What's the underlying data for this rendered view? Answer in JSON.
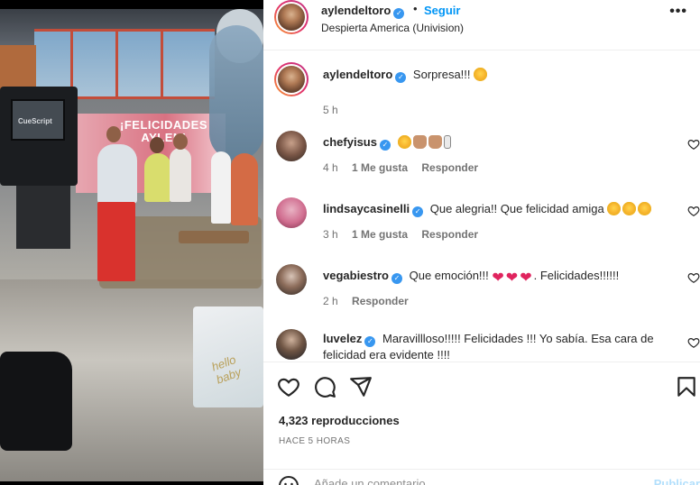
{
  "post": {
    "username": "aylendeltoro",
    "separator": "•",
    "follow_label": "Seguir",
    "location": "Despierta America (Univision)",
    "more_icon": "more-options-icon",
    "video_overlay": {
      "banner_text": "¡FELICIDADES\nAYLEN!",
      "camera_label": "CueScript",
      "bag_text": "hello baby"
    }
  },
  "caption": {
    "username": "aylendeltoro",
    "text": "Sorpresa!!!",
    "emoji": "smiling-face-with-hearts",
    "time": "5 h"
  },
  "comments": [
    {
      "username": "chefyisus",
      "text": "",
      "emojis": [
        "star-struck",
        "clapping-hands",
        "clapping-hands",
        "baby-bottle"
      ],
      "time": "4 h",
      "likes": "1 Me gusta",
      "reply": "Responder"
    },
    {
      "username": "lindsaycasinelli",
      "text": "Que alegria!! Que felicidad amiga",
      "emojis": [
        "star-struck",
        "star-struck",
        "star-struck"
      ],
      "time": "3 h",
      "likes": "1 Me gusta",
      "reply": "Responder"
    },
    {
      "username": "vegabiestro",
      "text_before": "Que emoción!!!",
      "text_after": ". Felicidades!!!!!!",
      "emojis": [
        "red-heart",
        "red-heart",
        "red-heart"
      ],
      "time": "2 h",
      "likes": "",
      "reply": "Responder"
    },
    {
      "username": "luvelez",
      "text": "Maravillloso!!!!! Felicidades !!! Yo sabía. Esa cara de felicidad era evidente !!!!",
      "emojis": [],
      "time": "",
      "likes": "",
      "reply": ""
    }
  ],
  "actions": {
    "icons": [
      "heart-icon",
      "comment-icon",
      "share-icon",
      "bookmark-icon"
    ],
    "views": "4,323 reproducciones",
    "posted_ago": "HACE 5 HORAS"
  },
  "add_comment": {
    "placeholder": "Añade un comentario...",
    "publish_label": "Publicar",
    "emoji_icon": "emoji-picker-icon"
  },
  "colors": {
    "link_blue": "#0095f6",
    "verified_blue": "#3897f0",
    "secondary_text": "#737373",
    "publish_disabled": "#b2dffc"
  }
}
